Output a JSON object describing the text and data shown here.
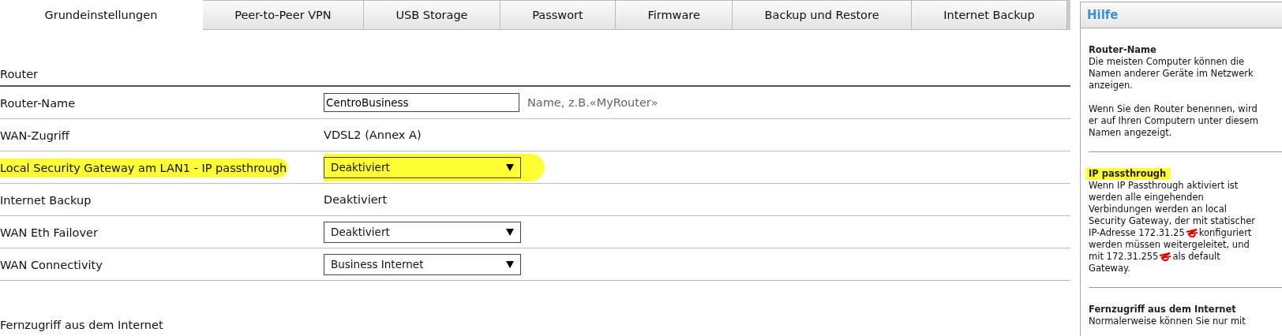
{
  "tabs": [
    {
      "label": "Grundeinstellungen",
      "selected": true
    },
    {
      "label": "Peer-to-Peer VPN",
      "selected": false
    },
    {
      "label": "USB Storage",
      "selected": false
    },
    {
      "label": "Passwort",
      "selected": false
    },
    {
      "label": "Firmware",
      "selected": false
    },
    {
      "label": "Backup und Restore",
      "selected": false
    },
    {
      "label": "Internet Backup",
      "selected": false
    }
  ],
  "sections": [
    {
      "title": "Router",
      "rows": [
        {
          "kind": "input",
          "label": "Router-Name",
          "value": "CentroBusiness",
          "hint": "Name, z.B.«MyRouter»",
          "highlighted": false
        },
        {
          "kind": "text",
          "label": "WAN-Zugriff",
          "value": "VDSL2 (Annex A)",
          "highlighted": false
        },
        {
          "kind": "select",
          "label": "Local Security Gateway am LAN1 - IP passthrough",
          "value": "Deaktiviert",
          "highlighted": true
        },
        {
          "kind": "text",
          "label": "Internet Backup",
          "value": "Deaktiviert",
          "highlighted": false
        },
        {
          "kind": "select",
          "label": "WAN Eth Failover",
          "value": "Deaktiviert",
          "highlighted": false
        },
        {
          "kind": "select",
          "label": "WAN Connectivity",
          "value": "Business Internet",
          "highlighted": false
        }
      ]
    },
    {
      "title": "Fernzugriff aus dem Internet"
    }
  ],
  "help": {
    "title": "Hilfe",
    "sections": [
      {
        "heading": "Router-Name",
        "highlighted": false,
        "paragraphs": [
          [
            [
              {
                "kind": "text",
                "text": "Die meisten Computer können die"
              }
            ],
            [
              {
                "kind": "text",
                "text": "Namen anderer Geräte im Netzwerk"
              }
            ],
            [
              {
                "kind": "text",
                "text": "anzeigen."
              }
            ]
          ],
          [
            [
              {
                "kind": "text",
                "text": "Wenn Sie den Router benennen, wird"
              }
            ],
            [
              {
                "kind": "text",
                "text": "er auf Ihren Computern unter diesem"
              }
            ],
            [
              {
                "kind": "text",
                "text": "Namen angezeigt."
              }
            ]
          ]
        ]
      },
      {
        "heading": "IP passthrough",
        "highlighted": true,
        "paragraphs": [
          [
            [
              {
                "kind": "text",
                "text": "Wenn IP Passthrough aktiviert ist"
              }
            ],
            [
              {
                "kind": "text",
                "text": "werden alle eingehenden"
              }
            ],
            [
              {
                "kind": "text",
                "text": "Verbindungen werden an local"
              }
            ],
            [
              {
                "kind": "text",
                "text": "Security Gateway, der mit statischer"
              }
            ],
            [
              {
                "kind": "text",
                "text": "IP-Adresse 172.31.25"
              },
              {
                "kind": "scribble"
              },
              {
                "kind": "text",
                "text": "konfiguriert"
              }
            ],
            [
              {
                "kind": "text",
                "text": "werden müssen weitergeleitet, und"
              }
            ],
            [
              {
                "kind": "text",
                "text": "mit 172.31.255"
              },
              {
                "kind": "scribble"
              },
              {
                "kind": "text",
                "text": "als default"
              }
            ],
            [
              {
                "kind": "text",
                "text": "Gateway."
              }
            ]
          ]
        ]
      },
      {
        "heading": "Fernzugriff aus dem Internet",
        "highlighted": false,
        "paragraphs": [
          [
            [
              {
                "kind": "text",
                "text": "Normalerweise können Sie nur mit"
              }
            ]
          ]
        ]
      }
    ]
  }
}
